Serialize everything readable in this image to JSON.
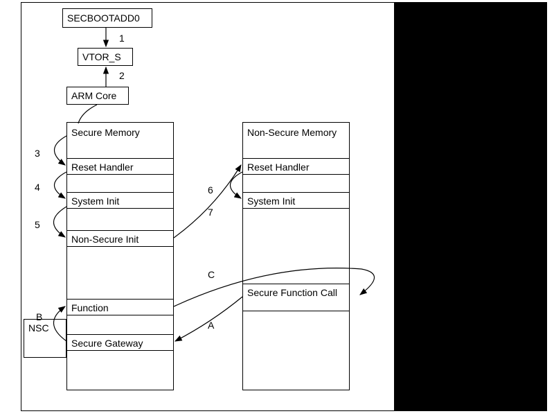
{
  "top": {
    "secbootadd0": "SECBOOTADD0",
    "vtor_s": "VTOR_S",
    "arm_core": "ARM Core"
  },
  "steps": {
    "s1": "1",
    "s2": "2",
    "s3": "3",
    "s4": "4",
    "s5": "5",
    "s6": "6",
    "s7": "7",
    "sA": "A",
    "sB": "B",
    "sC": "C"
  },
  "secure_mem": {
    "header": "Secure Memory",
    "reset_handler": "Reset Handler",
    "system_init": "System Init",
    "non_secure_init": "Non-Secure Init",
    "function": "Function",
    "secure_gateway": "Secure Gateway"
  },
  "nonsecure_mem": {
    "header": "Non-Secure Memory",
    "reset_handler": "Reset Handler",
    "system_init": "System Init",
    "secure_function_call": "Secure Function Call"
  },
  "nsc": "NSC"
}
